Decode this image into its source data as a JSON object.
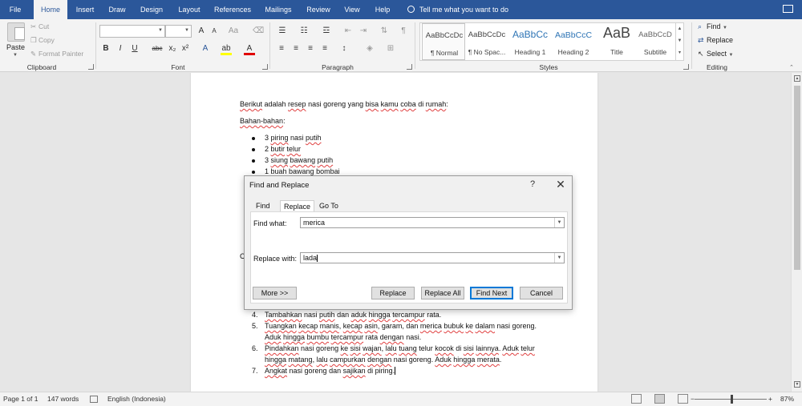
{
  "tabs": [
    "File",
    "Home",
    "Insert",
    "Draw",
    "Design",
    "Layout",
    "References",
    "Mailings",
    "Review",
    "View",
    "Help"
  ],
  "active_tab": "Home",
  "tell_me": "Tell me what you want to do",
  "ribbon": {
    "clipboard": {
      "paste": "Paste",
      "cut": "Cut",
      "copy": "Copy",
      "format_painter": "Format Painter",
      "label": "Clipboard"
    },
    "font": {
      "label": "Font",
      "grow": "A",
      "shrink": "A",
      "case": "Aa",
      "bold": "B",
      "italic": "I",
      "underline": "U",
      "strike": "abc",
      "sub": "x₂",
      "sup": "x²",
      "text_effects": "A",
      "highlight": "ab",
      "font_color": "A"
    },
    "paragraph": {
      "label": "Paragraph",
      "pilcrow": "¶"
    },
    "styles": {
      "label": "Styles",
      "items": [
        {
          "sample": "AaBbCcDc",
          "name": "¶ Normal"
        },
        {
          "sample": "AaBbCcDc",
          "name": "¶ No Spac..."
        },
        {
          "sample": "AaBbCc",
          "name": "Heading 1"
        },
        {
          "sample": "AaBbCcC",
          "name": "Heading 2"
        },
        {
          "sample": "AaB",
          "name": "Title"
        },
        {
          "sample": "AaBbCcD",
          "name": "Subtitle"
        }
      ]
    },
    "editing": {
      "label": "Editing",
      "find": "Find",
      "replace": "Replace",
      "select": "Select"
    }
  },
  "document": {
    "intro": [
      "Berikut",
      " adalah ",
      "resep",
      " nasi goreng yang ",
      "bisa",
      " ",
      "kamu",
      " ",
      "coba",
      " di ",
      "rumah",
      ":"
    ],
    "heading": "Bahan-bahan",
    "heading_suffix": ":",
    "bullets": [
      [
        "3 ",
        "piring",
        " nasi ",
        "putih"
      ],
      [
        "2 ",
        "butir",
        " ",
        "telur"
      ],
      [
        "3 ",
        "siung",
        " ",
        "bawang",
        " ",
        "putih"
      ],
      [
        "1 buah ",
        "bawang",
        " ",
        "bombai"
      ]
    ],
    "partial_letter": "C",
    "steps": [
      {
        "n": "4.",
        "lines": [
          [
            "Tambahkan",
            " nasi ",
            "putih",
            " dan ",
            "aduk",
            " ",
            "hingga",
            " ",
            "tercampur",
            " rata."
          ]
        ]
      },
      {
        "n": "5.",
        "lines": [
          [
            "Tuangkan",
            " ",
            "kecap",
            " ",
            "manis",
            ", ",
            "kecap",
            " ",
            "asin",
            ", garam, dan ",
            "merica",
            " ",
            "bubuk",
            " ",
            "ke",
            " ",
            "dalam",
            " nasi goreng."
          ],
          [
            "Aduk",
            " ",
            "hingga",
            " ",
            "bumbu",
            " ",
            "tercampur",
            " rata ",
            "dengan",
            " nasi."
          ]
        ]
      },
      {
        "n": "6.",
        "lines": [
          [
            "Pindahkan",
            " nasi goreng ",
            "ke",
            " ",
            "sisi",
            " ",
            "wajan",
            ", ",
            "lalu",
            " ",
            "tuang",
            " telur ",
            "kocok",
            " di ",
            "sisi",
            " ",
            "lainnya",
            ". ",
            "Aduk",
            " ",
            "telur"
          ],
          [
            "hingga",
            " ",
            "matang",
            ", ",
            "lalu",
            " ",
            "campurkan",
            " ",
            "dengan",
            " nasi goreng. ",
            "Aduk",
            " ",
            "hingga",
            " ",
            "merata",
            "."
          ]
        ]
      },
      {
        "n": "7.",
        "lines": [
          [
            "Angkat",
            " nasi goreng dan ",
            "sajikan",
            " di piring."
          ]
        ]
      }
    ]
  },
  "dialog": {
    "title": "Find and Replace",
    "help": "?",
    "close": "✕",
    "tabs": [
      "Find",
      "Replace",
      "Go To"
    ],
    "find_label": "Find what:",
    "find_value": "merica",
    "replace_label": "Replace with:",
    "replace_value": "lada",
    "buttons": {
      "more": "More >>",
      "replace": "Replace",
      "replace_all": "Replace All",
      "find_next": "Find Next",
      "cancel": "Cancel"
    }
  },
  "status": {
    "page": "Page 1 of 1",
    "words": "147 words",
    "language": "English (Indonesia)",
    "zoom": "87%",
    "zoom_minus": "−",
    "zoom_plus": "+"
  },
  "colors": {
    "brand": "#2b579a",
    "squiggle": "#e04040",
    "focus": "#0078d7"
  }
}
